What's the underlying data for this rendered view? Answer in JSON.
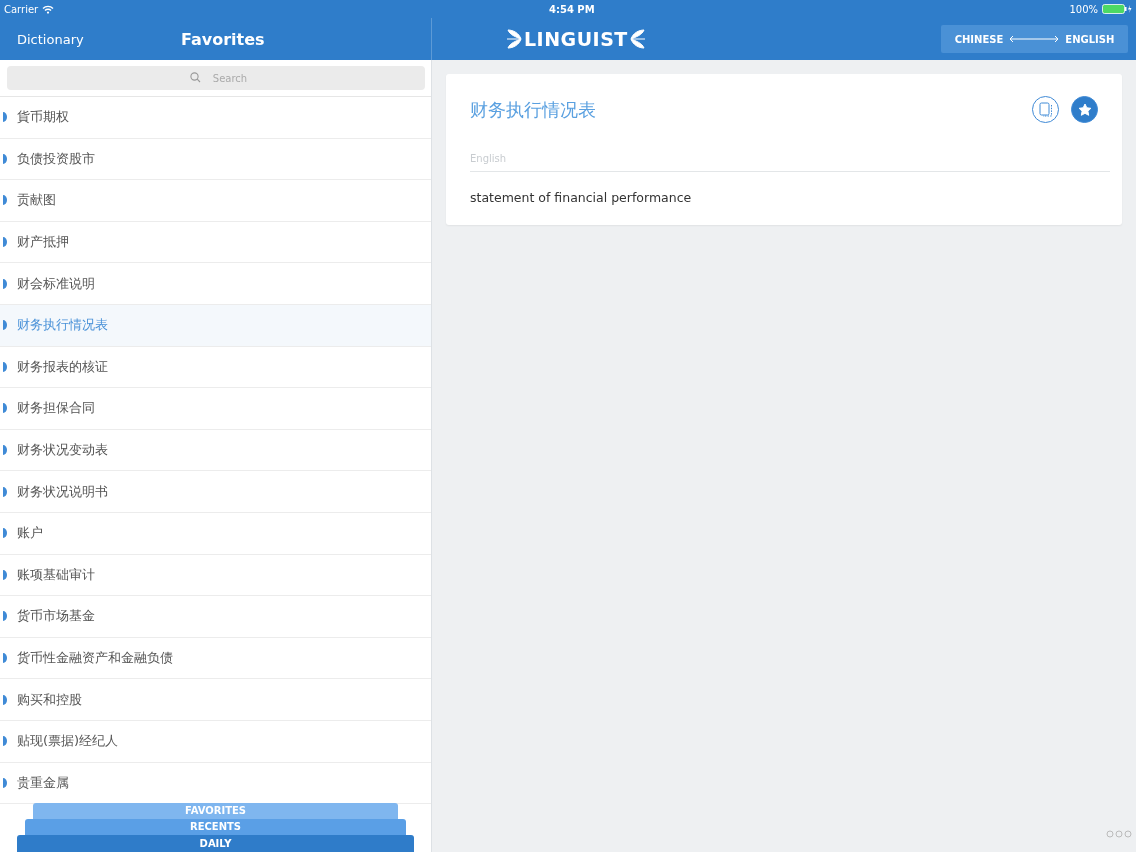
{
  "status_bar": {
    "carrier": "Carrier",
    "time": "4:54 PM",
    "battery": "100%"
  },
  "nav": {
    "back": "Dictionary",
    "title": "Favorites",
    "logo": "LINGUIST",
    "language_from": "CHINESE",
    "language_to": "ENGLISH"
  },
  "search": {
    "placeholder": "Search"
  },
  "terms": [
    {
      "label": "貨币期权",
      "selected": false
    },
    {
      "label": "负债投资股市",
      "selected": false
    },
    {
      "label": "贡献图",
      "selected": false
    },
    {
      "label": "财产抵押",
      "selected": false
    },
    {
      "label": "财会标准说明",
      "selected": false
    },
    {
      "label": "财务执行情况表",
      "selected": true
    },
    {
      "label": "财务报表的核证",
      "selected": false
    },
    {
      "label": "财务担保合同",
      "selected": false
    },
    {
      "label": "财务状况变动表",
      "selected": false
    },
    {
      "label": "财务状况说明书",
      "selected": false
    },
    {
      "label": "账户",
      "selected": false
    },
    {
      "label": "账项基础审计",
      "selected": false
    },
    {
      "label": "货币市场基金",
      "selected": false
    },
    {
      "label": "货币性金融资产和金融负债",
      "selected": false
    },
    {
      "label": "购买和控股",
      "selected": false
    },
    {
      "label": "贴现(票据)经纪人",
      "selected": false
    },
    {
      "label": "贵重金属",
      "selected": false
    }
  ],
  "bottom_tabs": [
    {
      "label": "FAVORITES",
      "selected": false
    },
    {
      "label": "RECENTS",
      "selected": false
    },
    {
      "label": "DAILY",
      "selected": true
    }
  ],
  "entry": {
    "term": "财务执行情况表",
    "favorite": true,
    "language": "English",
    "translation": "statement of financial performance"
  }
}
